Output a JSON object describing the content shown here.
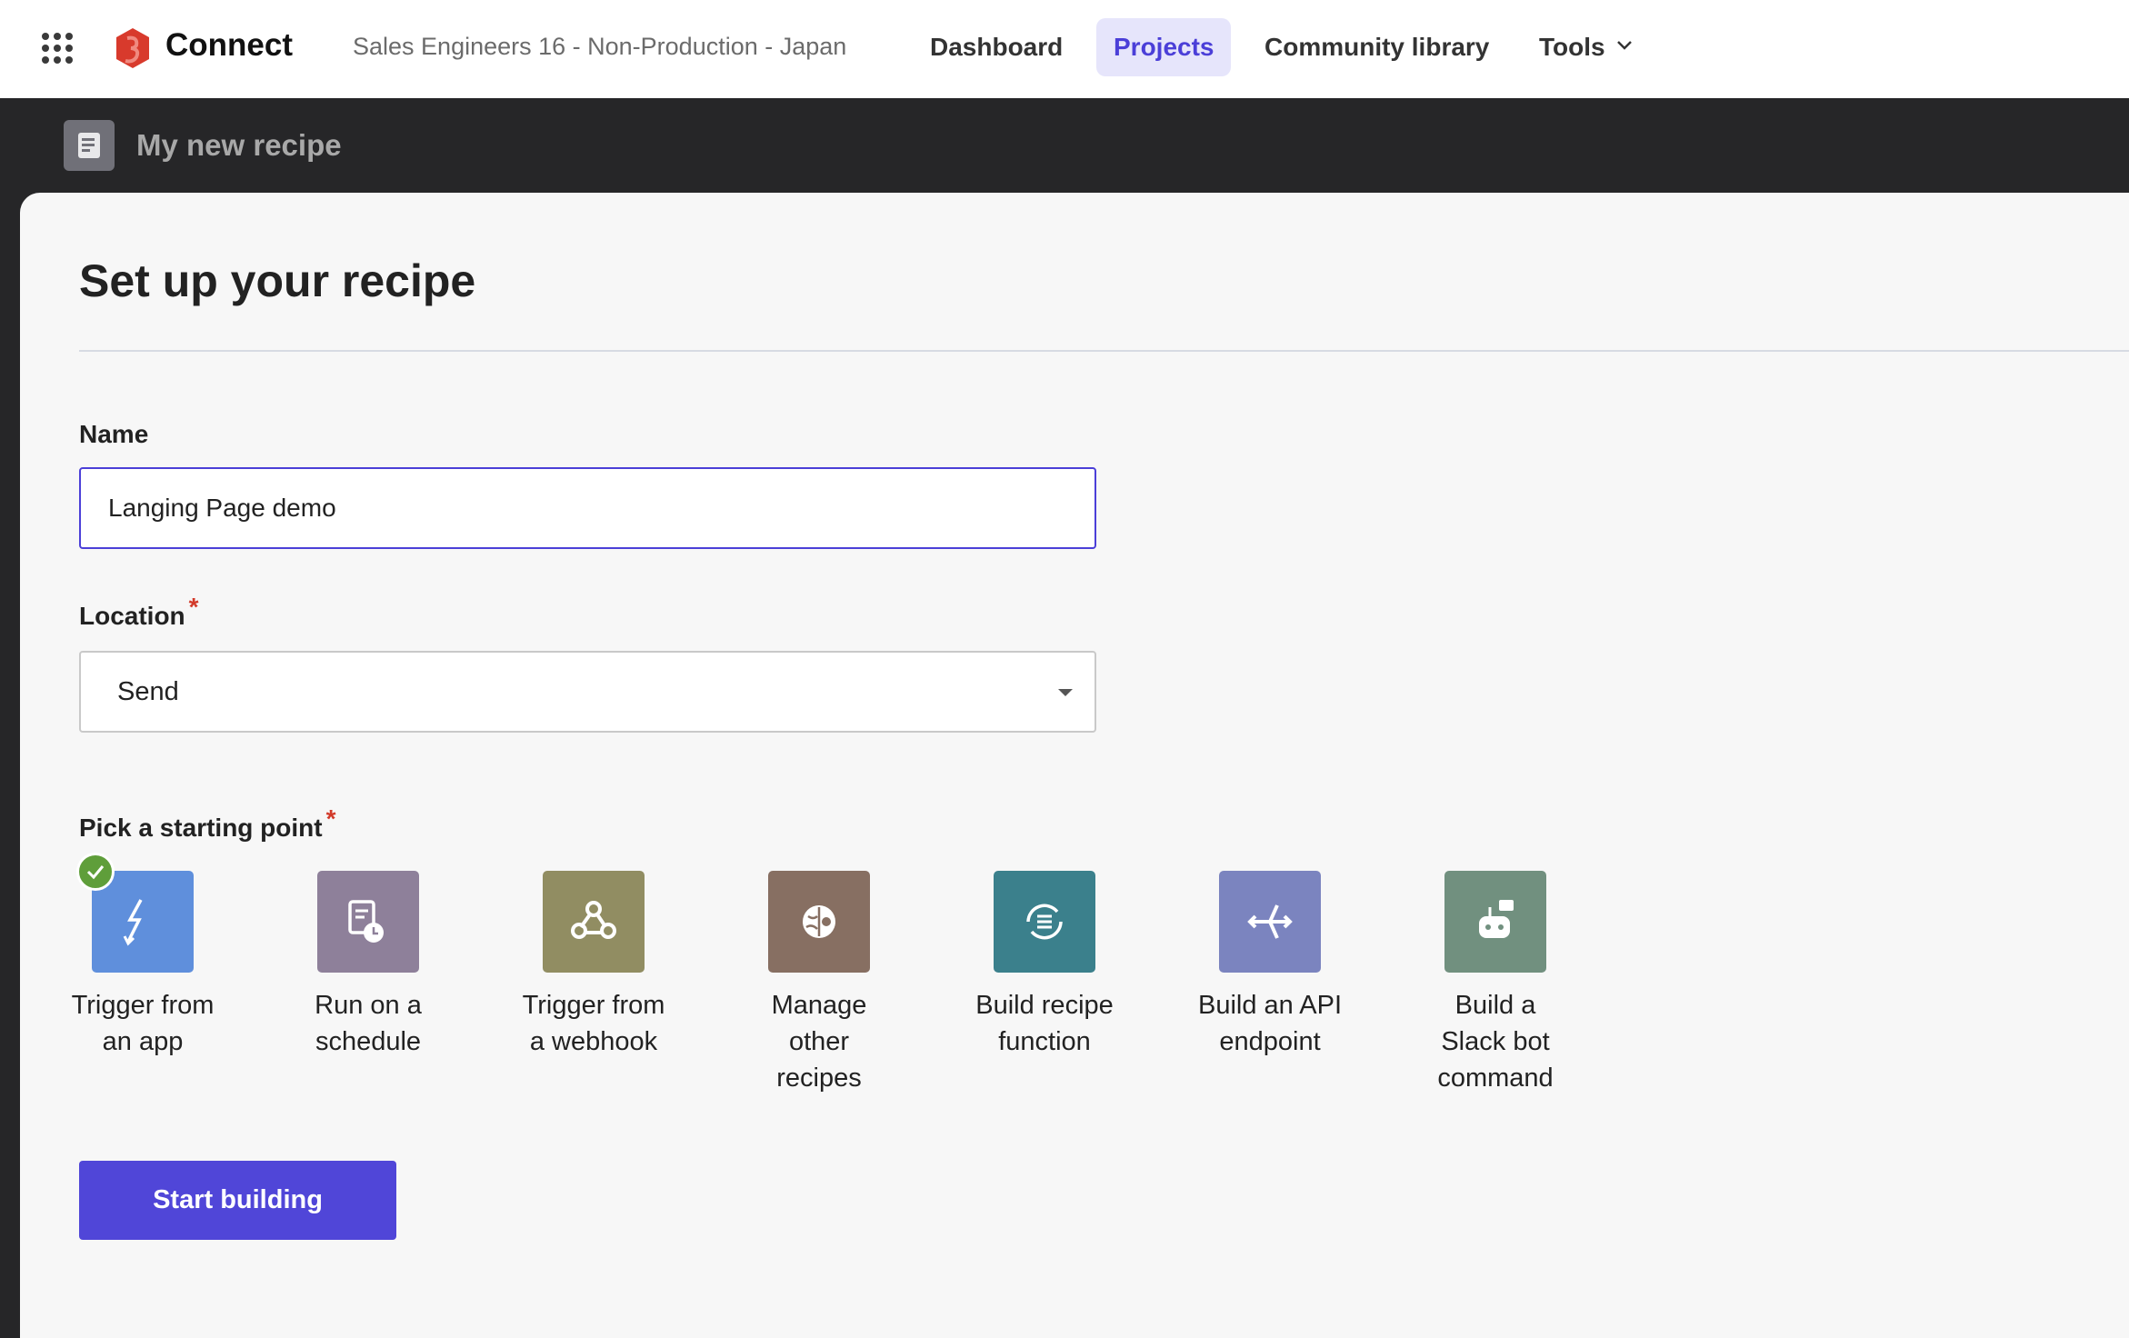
{
  "topbar": {
    "brand": "Connect",
    "workspace": "Sales Engineers 16 - Non-Production - Japan",
    "nav": [
      {
        "label": "Dashboard",
        "active": false
      },
      {
        "label": "Projects",
        "active": true
      },
      {
        "label": "Community library",
        "active": false
      },
      {
        "label": "Tools",
        "active": false,
        "has_dropdown": true
      }
    ],
    "accent_color": "#4b3fd8"
  },
  "subbar": {
    "title": "My new recipe",
    "icon": "recipe-document-icon"
  },
  "main": {
    "heading": "Set up your recipe",
    "name": {
      "label": "Name",
      "value": "Langing Page demo"
    },
    "location": {
      "label": "Location",
      "required_mark": "*",
      "selected": "Send"
    },
    "starting_point": {
      "label": "Pick a starting point",
      "required_mark": "*",
      "options": [
        {
          "line1": "Trigger from",
          "line2": "an app",
          "line3": "",
          "icon": "lightning-icon",
          "color": "#5f8fdc",
          "selected": true
        },
        {
          "line1": "Run on a",
          "line2": "schedule",
          "line3": "",
          "icon": "schedule-clock-icon",
          "color": "#8e809a",
          "selected": false
        },
        {
          "line1": "Trigger from",
          "line2": "a webhook",
          "line3": "",
          "icon": "webhook-icon",
          "color": "#918d62",
          "selected": false
        },
        {
          "line1": "Manage",
          "line2": "other",
          "line3": "recipes",
          "icon": "brain-gear-icon",
          "color": "#876f62",
          "selected": false
        },
        {
          "line1": "Build recipe",
          "line2": "function",
          "line3": "",
          "icon": "function-cycle-icon",
          "color": "#3b808c",
          "selected": false
        },
        {
          "line1": "Build an API",
          "line2": "endpoint",
          "line3": "",
          "icon": "api-endpoint-icon",
          "color": "#7b84bf",
          "selected": false
        },
        {
          "line1": "Build a",
          "line2": "Slack bot",
          "line3": "command",
          "icon": "bot-icon",
          "color": "#71907f",
          "selected": false
        }
      ]
    },
    "start_button": "Start building"
  }
}
